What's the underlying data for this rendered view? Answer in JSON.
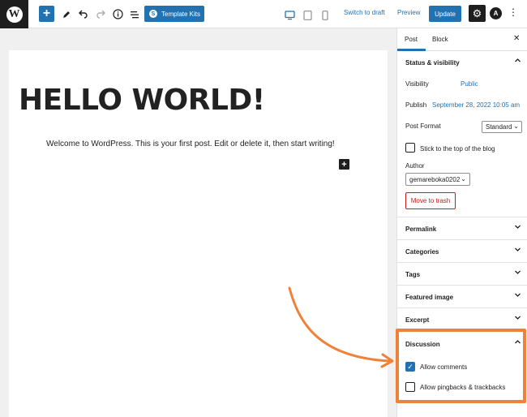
{
  "toolbar": {
    "logo": "W",
    "add_block": "+",
    "icons": [
      "pencil-icon",
      "undo-icon",
      "redo-icon",
      "info-icon",
      "list-view-icon"
    ],
    "template_kits_label": "Template Kits",
    "template_kits_icon": "S",
    "switch_to_draft": "Switch to draft",
    "preview": "Preview",
    "update": "Update",
    "astra_icon": "A"
  },
  "editor": {
    "title": "HELLO WORLD!",
    "paragraph": "Welcome to WordPress. This is your first post. Edit or delete it, then start writing!",
    "add_block": "+"
  },
  "sidebar": {
    "tabs": {
      "post": "Post",
      "block": "Block"
    },
    "close": "✕",
    "status": {
      "title": "Status & visibility",
      "visibility_label": "Visibility",
      "visibility_value": "Public",
      "publish_label": "Publish",
      "publish_value": "September 28, 2022 10:05 am",
      "format_label": "Post Format",
      "format_value": "Standard",
      "sticky_label": "Stick to the top of the blog",
      "author_label": "Author",
      "author_value": "gemareboka0202",
      "trash": "Move to trash"
    },
    "panels": {
      "permalink": "Permalink",
      "categories": "Categories",
      "tags": "Tags",
      "featured_image": "Featured image",
      "excerpt": "Excerpt"
    },
    "discussion": {
      "title": "Discussion",
      "allow_comments": "Allow comments",
      "allow_comments_checked": true,
      "allow_pingbacks": "Allow pingbacks & trackbacks",
      "allow_pingbacks_checked": false
    }
  },
  "colors": {
    "accent": "#2271b1",
    "highlight": "#ef8239",
    "danger": "#cc1818",
    "dark": "#1e1e1e"
  }
}
